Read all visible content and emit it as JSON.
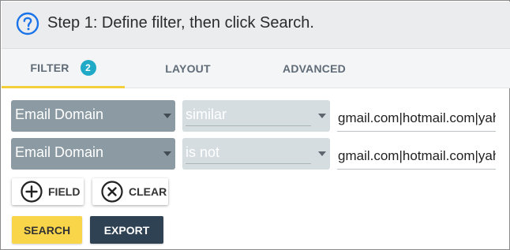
{
  "header": {
    "icon": "help-circle-icon",
    "title": "Step 1: Define filter, then click Search."
  },
  "tabs": [
    {
      "label": "FILTER",
      "badge": "2",
      "active": true
    },
    {
      "label": "LAYOUT",
      "active": false
    },
    {
      "label": "ADVANCED",
      "active": false
    }
  ],
  "filters": [
    {
      "field": "Email Domain",
      "operator": "similar",
      "value": "gmail.com|hotmail.com|yahoo.com"
    },
    {
      "field": "Email Domain",
      "operator": "is not",
      "value": "gmail.com|hotmail.com|yahoo.com"
    }
  ],
  "actions": {
    "add_field_label": "FIELD",
    "clear_label": "CLEAR",
    "search_label": "SEARCH",
    "export_label": "EXPORT"
  },
  "colors": {
    "accent_yellow": "#f9d54a",
    "badge_blue": "#21a9c8",
    "help_icon_blue": "#1a73e8",
    "field_select": "#8c9ba3",
    "operator_select": "#d5dde0",
    "export_button": "#2f4254"
  }
}
